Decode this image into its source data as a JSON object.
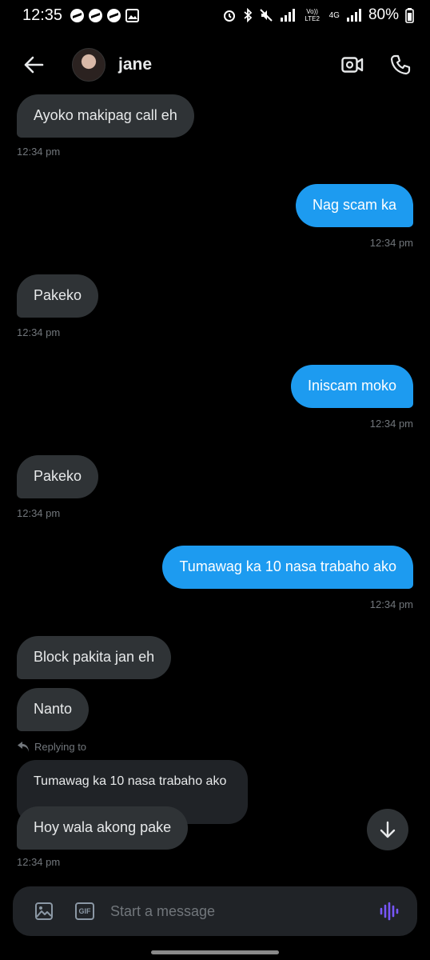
{
  "status_bar": {
    "time": "12:35",
    "battery": "80%",
    "network_labels": [
      "Vo)) LTE2",
      "4G"
    ]
  },
  "header": {
    "contact_name": "jane"
  },
  "messages": [
    {
      "dir": "in",
      "text": "Ayoko makipag call eh",
      "time": "12:34 pm"
    },
    {
      "dir": "out",
      "text": "Nag scam ka",
      "time": "12:34 pm"
    },
    {
      "dir": "in",
      "text": "Pakeko",
      "time": "12:34 pm"
    },
    {
      "dir": "out",
      "text": "Iniscam moko",
      "time": "12:34 pm"
    },
    {
      "dir": "in",
      "text": "Pakeko",
      "time": "12:34 pm"
    },
    {
      "dir": "out",
      "text": "Tumawag ka 10 nasa trabaho ako",
      "time": "12:34 pm"
    },
    {
      "dir": "in",
      "text": "Block pakita jan eh"
    },
    {
      "dir": "in",
      "text": "Nanto"
    },
    {
      "dir": "in",
      "text": "Hoy wala akong pake",
      "time": "12:34 pm"
    }
  ],
  "reply": {
    "label": "Replying to",
    "quoted_text": "Tumawag ka 10 nasa trabaho ako"
  },
  "composer": {
    "placeholder": "Start a message"
  },
  "icons": {
    "back": "arrow-left-icon",
    "video_call": "video-camera-icon",
    "voice_call": "phone-icon",
    "image": "image-icon",
    "gif": "gif-icon",
    "voice_message": "waveform-icon",
    "scroll_down": "arrow-down-icon"
  },
  "colors": {
    "background": "#000000",
    "incoming_bubble": "#2f3336",
    "outgoing_bubble": "#1d9bf0",
    "timestamp": "#71767b",
    "voice_accent": "#7856ff"
  }
}
